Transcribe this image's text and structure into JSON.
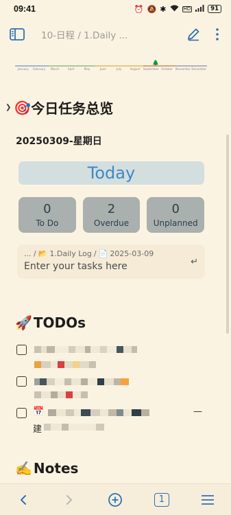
{
  "status_bar": {
    "time": "09:41",
    "battery": "91",
    "icons": [
      "alarm-icon",
      "silent-icon",
      "bluetooth-icon",
      "wifi-icon",
      "hd-icon",
      "signal-icon"
    ]
  },
  "app_bar": {
    "title": "10-日程 / 1.Daily ...",
    "icons": [
      "sidebar-icon",
      "edit-icon",
      "more-icon"
    ]
  },
  "timeline": {
    "months": [
      "January",
      "February",
      "March",
      "April",
      "May",
      "June",
      "July",
      "August",
      "September",
      "October",
      "November",
      "December"
    ],
    "colors": [
      "#9bb7d4",
      "#9bb7d4",
      "#a8c9a0",
      "#a8c9a0",
      "#a8c9a0",
      "#e6c97a",
      "#e6c97a",
      "#e6c97a",
      "#d9a27a",
      "#d9a27a",
      "#b0b0c8",
      "#b0b0c8"
    ]
  },
  "overview": {
    "heading_emoji": "🎯",
    "heading": "今日任务总览",
    "date": "20250309-星期日",
    "today_button": "Today",
    "stats": [
      {
        "value": "0",
        "label": "To Do"
      },
      {
        "value": "2",
        "label": "Overdue"
      },
      {
        "value": "0",
        "label": "Unplanned"
      }
    ],
    "task_input": {
      "path_prefix": "... /",
      "folder_emoji": "📂",
      "folder": "1.Daily Log",
      "sep": "/",
      "file_emoji": "📄",
      "file": "2025-03-09",
      "placeholder": "Enter your tasks here"
    }
  },
  "todos": {
    "heading_emoji": "🚀",
    "heading": "TODOs",
    "item3_emoji": "📅",
    "item3_suffix": "—",
    "item3_line2": "建"
  },
  "notes": {
    "heading_emoji": "✍️",
    "heading": "Notes"
  },
  "bottom_bar": {
    "tab_count": "1",
    "icons": [
      "back-icon",
      "forward-icon",
      "new-tab-icon",
      "tabs-icon",
      "menu-icon"
    ]
  }
}
